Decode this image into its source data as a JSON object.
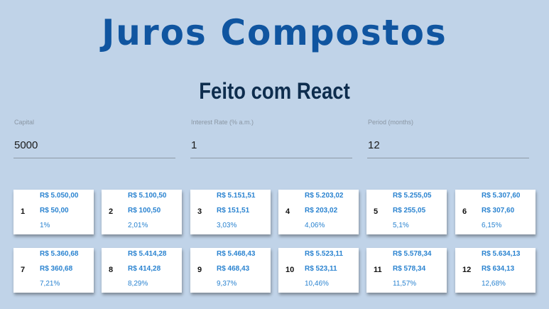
{
  "header": {
    "title": "Juros Compostos",
    "subtitle": "Feito com React"
  },
  "form": {
    "capital": {
      "label": "Capital",
      "value": "5000"
    },
    "interest_rate": {
      "label": "Interest Rate (% a.m.)",
      "value": "1"
    },
    "period": {
      "label": "Period (months)",
      "value": "12"
    }
  },
  "colors": {
    "background": "#c0d3e8",
    "title": "#1055a0",
    "subtitle": "#0e2d4e",
    "gain": "#2a83d0",
    "loss": "#c0392b"
  },
  "installments": [
    {
      "month": "1",
      "total": "R$ 5.050,00",
      "interest": "R$ 50,00",
      "percent": "1%"
    },
    {
      "month": "2",
      "total": "R$ 5.100,50",
      "interest": "R$ 100,50",
      "percent": "2,01%"
    },
    {
      "month": "3",
      "total": "R$ 5.151,51",
      "interest": "R$ 151,51",
      "percent": "3,03%"
    },
    {
      "month": "4",
      "total": "R$ 5.203,02",
      "interest": "R$ 203,02",
      "percent": "4,06%"
    },
    {
      "month": "5",
      "total": "R$ 5.255,05",
      "interest": "R$ 255,05",
      "percent": "5,1%"
    },
    {
      "month": "6",
      "total": "R$ 5.307,60",
      "interest": "R$ 307,60",
      "percent": "6,15%"
    },
    {
      "month": "7",
      "total": "R$ 5.360,68",
      "interest": "R$ 360,68",
      "percent": "7,21%"
    },
    {
      "month": "8",
      "total": "R$ 5.414,28",
      "interest": "R$ 414,28",
      "percent": "8,29%"
    },
    {
      "month": "9",
      "total": "R$ 5.468,43",
      "interest": "R$ 468,43",
      "percent": "9,37%"
    },
    {
      "month": "10",
      "total": "R$ 5.523,11",
      "interest": "R$ 523,11",
      "percent": "10,46%"
    },
    {
      "month": "11",
      "total": "R$ 5.578,34",
      "interest": "R$ 578,34",
      "percent": "11,57%"
    },
    {
      "month": "12",
      "total": "R$ 5.634,13",
      "interest": "R$ 634,13",
      "percent": "12,68%"
    }
  ]
}
